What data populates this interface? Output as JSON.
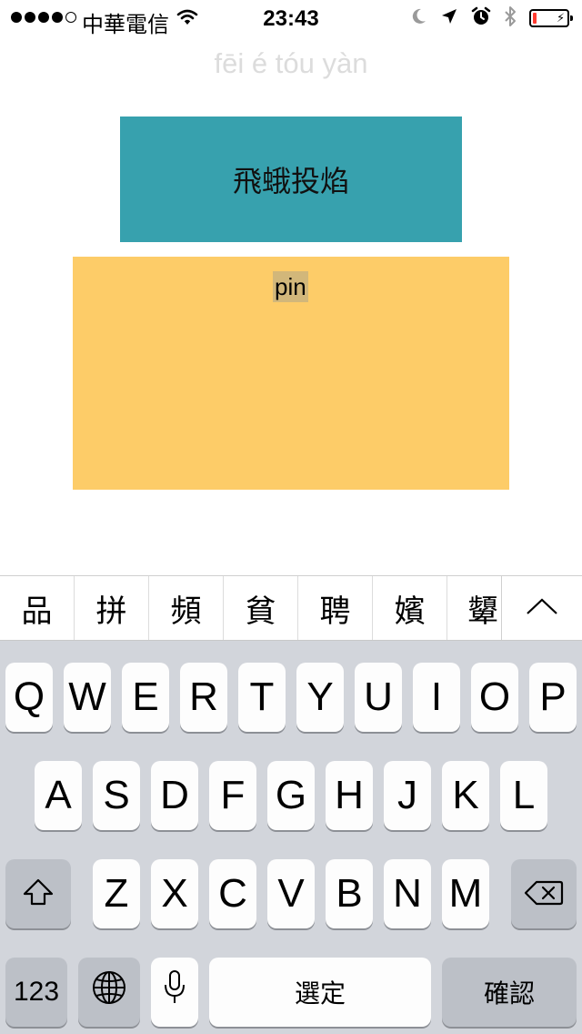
{
  "status_bar": {
    "carrier": "中華電信",
    "time": "23:43",
    "signal_strength": 4,
    "signal_max": 5,
    "battery_level": 0.12,
    "icons": [
      "wifi-icon",
      "moon-icon",
      "location-arrow-icon",
      "alarm-icon",
      "bluetooth-icon",
      "battery-icon",
      "charging-bolt-icon"
    ]
  },
  "game": {
    "pinyin_hint": "fēi é tóu yàn",
    "idiom": "飛蛾投焰",
    "input_text": "pin"
  },
  "candidates": [
    "品",
    "拼",
    "頻",
    "貧",
    "聘",
    "嬪",
    "顰"
  ],
  "keyboard": {
    "row1": [
      "Q",
      "W",
      "E",
      "R",
      "T",
      "Y",
      "U",
      "I",
      "O",
      "P"
    ],
    "row2": [
      "A",
      "S",
      "D",
      "F",
      "G",
      "H",
      "J",
      "K",
      "L"
    ],
    "row3": [
      "Z",
      "X",
      "C",
      "V",
      "B",
      "N",
      "M"
    ],
    "numbers_label": "123",
    "space_label": "選定",
    "return_label": "確認"
  },
  "colors": {
    "idiom_box": "#37a1ae",
    "input_box": "#fdcc68",
    "input_highlight": "#d2b77a",
    "keyboard_bg": "#d2d5db",
    "battery": "#ff3b30"
  }
}
